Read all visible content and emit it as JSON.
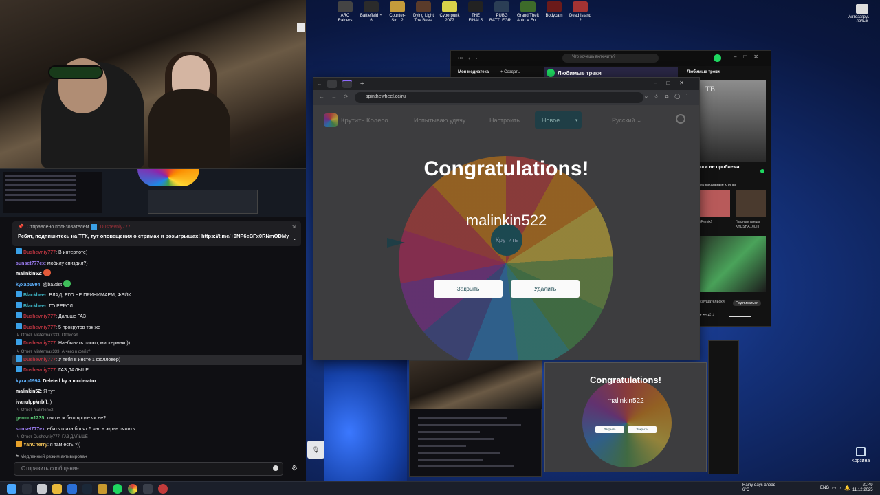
{
  "desktop": {
    "icons": [
      {
        "label": "ARC Raiders",
        "color": "#444444"
      },
      {
        "label": "Battlefield™ 6",
        "color": "#2b2b2b"
      },
      {
        "label": "Counter-Str... 2",
        "color": "#c49b3b"
      },
      {
        "label": "Dying Light The Beast",
        "color": "#5a3b2a"
      },
      {
        "label": "Cyberpunk 2077",
        "color": "#d8d24a"
      },
      {
        "label": "THE FINALS",
        "color": "#222222"
      },
      {
        "label": "PUBG BATTLEGR...",
        "color": "#2b3e55"
      },
      {
        "label": "Grand Theft Auto V En...",
        "color": "#3d6b2a"
      },
      {
        "label": "Bodycam",
        "color": "#6b1a1a"
      },
      {
        "label": "Dead Island 2",
        "color": "#a33333"
      }
    ],
    "right_icon_label": "Автозагру... — ярлык",
    "trash_label": "Корзина"
  },
  "chat": {
    "pinned": {
      "header": "Отправлено пользователем",
      "user": "Dushevniy777",
      "text": "Ребят, подпишитесь на ТГК, тут оповещения о стримах и розыгрышах!",
      "link": "https://t.me/+9NP6eBFx0RNmODMy"
    },
    "messages": [
      {
        "type": "msg",
        "badge": true,
        "user": "Dushevniy777",
        "color": "#b5343f",
        "text": ": В интерпоте)"
      },
      {
        "type": "msg",
        "badge": false,
        "user": "sunset777ex",
        "color": "#9b7cf0",
        "text": ": мобилу спиздил?)"
      },
      {
        "type": "msg",
        "badge": false,
        "user": "malinkin52",
        "color": "#ffffff",
        "text": ": ",
        "emote": "#e25a3a"
      },
      {
        "type": "msg",
        "badge": false,
        "user": "kyxap1994",
        "color": "#5fb3ff",
        "text": ": @ba2tist ",
        "emote": "#3fbf5a"
      },
      {
        "type": "msg",
        "badge": true,
        "user": "Blackbeer",
        "color": "#3fb8c9",
        "text": ": ВЛАД, ЕГО НЕ ПРИНИМАЕМ, ФЭЙК"
      },
      {
        "type": "msg",
        "badge": true,
        "user": "Blackbeer",
        "color": "#3fb8c9",
        "text": ": ГО РЕРОЛ"
      },
      {
        "type": "msg",
        "badge": true,
        "user": "Dushevniy777",
        "color": "#b5343f",
        "text": ": Дальше ГАЗ"
      },
      {
        "type": "msg",
        "badge": true,
        "user": "Dushevniy777",
        "color": "#b5343f",
        "text": ": 5 прокрутов так же"
      },
      {
        "type": "reply",
        "text": "Ответ Mistermax333: Отписал"
      },
      {
        "type": "msg",
        "badge": true,
        "user": "Dushevniy777",
        "color": "#b5343f",
        "text": ": Наебывать плохо, мистермакс))"
      },
      {
        "type": "reply",
        "text": "Ответ Mistermax333: А чего в фейк?"
      },
      {
        "type": "msg",
        "badge": true,
        "user": "Dushevniy777",
        "color": "#b5343f",
        "text": ": У тебя в инсте 1 фолловер)",
        "highlight": true
      },
      {
        "type": "msg",
        "badge": true,
        "user": "Dushevniy777",
        "color": "#b5343f",
        "text": ": ГАЗ ДАЛЬШЕ"
      },
      {
        "type": "msg",
        "badge": false,
        "user": "kyxap1994",
        "color": "#5fb3ff",
        "text": ": ",
        "deleted": "Deleted by a moderator"
      },
      {
        "type": "msg",
        "badge": false,
        "user": "malinkin52",
        "color": "#ffffff",
        "text": ": Я тут"
      },
      {
        "type": "msg",
        "badge": false,
        "user": "ivanulppknbff",
        "color": "#ffffff",
        "text": ": )"
      },
      {
        "type": "reply",
        "text": "Ответ malinkin52: "
      },
      {
        "type": "msg",
        "badge": false,
        "user": "germon1235",
        "color": "#5fd07a",
        "text": ": так он ж был вроде чи не?"
      },
      {
        "type": "msg",
        "badge": false,
        "user": "sunset777ex",
        "color": "#9b7cf0",
        "text": ": ебать глаза болят 5 час в экран пялить"
      },
      {
        "type": "reply",
        "text": "Ответ Dushevniy777: ГАЗ ДАЛЬШЕ"
      },
      {
        "type": "msg",
        "badge": true,
        "gold": true,
        "user": "YanCherry",
        "color": "#f0c25a",
        "text": ": я там есть ?))"
      }
    ],
    "slow_mode": "Медленный режим активирован",
    "input_placeholder": "Отправить сообщение"
  },
  "music": {
    "search_placeholder": "Что хочешь включить?",
    "library": "Моя медиатека",
    "create": "+ Создать",
    "favorites": "Любимые треки",
    "loved": "Любимые треки",
    "cover_text": "TB",
    "track": "оги не проблема",
    "clips": "музыкальные клипы",
    "remix": "(Remix)",
    "tile_title": "Грязные танцы",
    "artist": "KYUSHA, ЛСП",
    "listening": "слушательски",
    "subscribe": "Подписаться"
  },
  "browser": {
    "url": "spinthewheel.cc/ru",
    "site_name": "Крутить Колесо",
    "nav": [
      "Испытываю удачу",
      "Настроить"
    ],
    "new_button": "Новое",
    "language": "Русский",
    "spin_label": "Крутить",
    "congrats": "Congratulations!",
    "winner": "malinkin522",
    "close_button": "Закрыть",
    "delete_button": "Удалить"
  },
  "taskbar": {
    "weather": "Rainy days ahead",
    "temp": "6°C",
    "lang": "ENG",
    "time": "21:49",
    "date": "11.12.2025"
  }
}
